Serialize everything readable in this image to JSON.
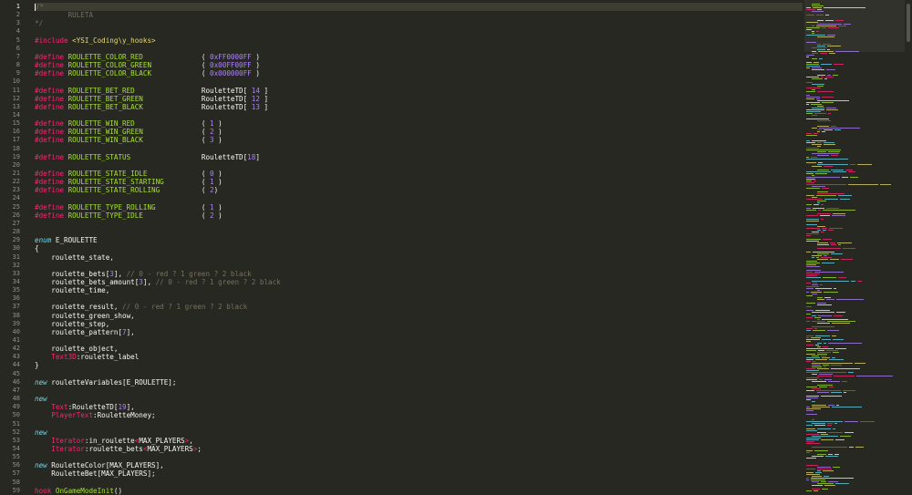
{
  "editor": {
    "theme_colors": {
      "background": "#272822",
      "comment": "#75715e",
      "preprocessor": "#f92672",
      "definition": "#a6e22e",
      "number": "#ae81ff",
      "keyword": "#66d9ef",
      "text": "#f8f8f2"
    },
    "active_line": 1,
    "lines": [
      {
        "n": "1",
        "t": [
          [
            "c-comment",
            "/*"
          ]
        ]
      },
      {
        "n": "2",
        "t": [
          [
            "c-comment",
            "        RULETA"
          ]
        ]
      },
      {
        "n": "3",
        "t": [
          [
            "c-comment",
            "*/"
          ]
        ]
      },
      {
        "n": "4",
        "t": []
      },
      {
        "n": "5",
        "t": [
          [
            "c-pre",
            "#include "
          ],
          [
            "c-str",
            "<YSI_Coding\\y_hooks>"
          ]
        ]
      },
      {
        "n": "6",
        "t": []
      },
      {
        "n": "7",
        "t": [
          [
            "c-pre",
            "#define "
          ],
          [
            "c-def",
            "ROULETTE_COLOR_RED"
          ],
          [
            "c-plain",
            "              ( "
          ],
          [
            "c-num",
            "0xFF0000FF"
          ],
          [
            "c-plain",
            " )"
          ]
        ]
      },
      {
        "n": "8",
        "t": [
          [
            "c-pre",
            "#define "
          ],
          [
            "c-def",
            "ROULETTE_COLOR_GREEN"
          ],
          [
            "c-plain",
            "            ( "
          ],
          [
            "c-num",
            "0x00FF00FF"
          ],
          [
            "c-plain",
            " )"
          ]
        ]
      },
      {
        "n": "9",
        "t": [
          [
            "c-pre",
            "#define "
          ],
          [
            "c-def",
            "ROULETTE_COLOR_BLACK"
          ],
          [
            "c-plain",
            "            ( "
          ],
          [
            "c-num",
            "0x000000FF"
          ],
          [
            "c-plain",
            " )"
          ]
        ]
      },
      {
        "n": "10",
        "t": []
      },
      {
        "n": "11",
        "t": [
          [
            "c-pre",
            "#define "
          ],
          [
            "c-def",
            "ROULETTE_BET_RED"
          ],
          [
            "c-plain",
            "                RouletteTD[ "
          ],
          [
            "c-num",
            "14"
          ],
          [
            "c-plain",
            " ]"
          ]
        ]
      },
      {
        "n": "12",
        "t": [
          [
            "c-pre",
            "#define "
          ],
          [
            "c-def",
            "ROULETTE_BET_GREEN"
          ],
          [
            "c-plain",
            "              RouletteTD[ "
          ],
          [
            "c-num",
            "12"
          ],
          [
            "c-plain",
            " ]"
          ]
        ]
      },
      {
        "n": "13",
        "t": [
          [
            "c-pre",
            "#define "
          ],
          [
            "c-def",
            "ROULETTE_BET_BLACK"
          ],
          [
            "c-plain",
            "              RouletteTD[ "
          ],
          [
            "c-num",
            "13"
          ],
          [
            "c-plain",
            " ]"
          ]
        ]
      },
      {
        "n": "14",
        "t": []
      },
      {
        "n": "15",
        "t": [
          [
            "c-pre",
            "#define "
          ],
          [
            "c-def",
            "ROULETTE_WIN_RED"
          ],
          [
            "c-plain",
            "                ( "
          ],
          [
            "c-num",
            "1"
          ],
          [
            "c-plain",
            " )"
          ]
        ]
      },
      {
        "n": "16",
        "t": [
          [
            "c-pre",
            "#define "
          ],
          [
            "c-def",
            "ROULETTE_WIN_GREEN"
          ],
          [
            "c-plain",
            "              ( "
          ],
          [
            "c-num",
            "2"
          ],
          [
            "c-plain",
            " )"
          ]
        ]
      },
      {
        "n": "17",
        "t": [
          [
            "c-pre",
            "#define "
          ],
          [
            "c-def",
            "ROULETTE_WIN_BLACK"
          ],
          [
            "c-plain",
            "              ( "
          ],
          [
            "c-num",
            "3"
          ],
          [
            "c-plain",
            " )"
          ]
        ]
      },
      {
        "n": "18",
        "t": []
      },
      {
        "n": "19",
        "t": [
          [
            "c-pre",
            "#define "
          ],
          [
            "c-def",
            "ROULETTE_STATUS"
          ],
          [
            "c-plain",
            "                 RouletteTD["
          ],
          [
            "c-num",
            "18"
          ],
          [
            "c-plain",
            "]"
          ]
        ]
      },
      {
        "n": "20",
        "t": []
      },
      {
        "n": "21",
        "t": [
          [
            "c-pre",
            "#define "
          ],
          [
            "c-def",
            "ROULETTE_STATE_IDLE"
          ],
          [
            "c-plain",
            "             ( "
          ],
          [
            "c-num",
            "0"
          ],
          [
            "c-plain",
            " )"
          ]
        ]
      },
      {
        "n": "22",
        "t": [
          [
            "c-pre",
            "#define "
          ],
          [
            "c-def",
            "ROULETTE_STATE_STARTING"
          ],
          [
            "c-plain",
            "         ( "
          ],
          [
            "c-num",
            "1"
          ],
          [
            "c-plain",
            " )"
          ]
        ]
      },
      {
        "n": "23",
        "t": [
          [
            "c-pre",
            "#define "
          ],
          [
            "c-def",
            "ROULETTE_STATE_ROLLING"
          ],
          [
            "c-plain",
            "          ( "
          ],
          [
            "c-num",
            "2"
          ],
          [
            "c-plain",
            ")"
          ]
        ]
      },
      {
        "n": "24",
        "t": []
      },
      {
        "n": "25",
        "t": [
          [
            "c-pre",
            "#define "
          ],
          [
            "c-def",
            "ROULETTE_TYPE_ROLLING"
          ],
          [
            "c-plain",
            "           ( "
          ],
          [
            "c-num",
            "1"
          ],
          [
            "c-plain",
            " )"
          ]
        ]
      },
      {
        "n": "26",
        "t": [
          [
            "c-pre",
            "#define "
          ],
          [
            "c-def",
            "ROULETTE_TYPE_IDLE"
          ],
          [
            "c-plain",
            "              ( "
          ],
          [
            "c-num",
            "2"
          ],
          [
            "c-plain",
            " )"
          ]
        ]
      },
      {
        "n": "27",
        "t": []
      },
      {
        "n": "28",
        "t": []
      },
      {
        "n": "29",
        "t": [
          [
            "c-kw",
            "enum"
          ],
          [
            "c-plain",
            " E_ROULETTE"
          ]
        ]
      },
      {
        "n": "30",
        "t": [
          [
            "c-plain",
            "{"
          ]
        ]
      },
      {
        "n": "31",
        "t": [
          [
            "c-plain",
            "    roulette_state,"
          ]
        ]
      },
      {
        "n": "32",
        "t": []
      },
      {
        "n": "33",
        "t": [
          [
            "c-plain",
            "    roulette_bets["
          ],
          [
            "c-num",
            "3"
          ],
          [
            "c-plain",
            "], "
          ],
          [
            "c-comment",
            "// 0 - red ? 1 green ? 2 black"
          ]
        ]
      },
      {
        "n": "34",
        "t": [
          [
            "c-plain",
            "    roulette_bets_amount["
          ],
          [
            "c-num",
            "3"
          ],
          [
            "c-plain",
            "], "
          ],
          [
            "c-comment",
            "// 0 - red ? 1 green ? 2 black"
          ]
        ]
      },
      {
        "n": "35",
        "t": [
          [
            "c-plain",
            "    roulette_time,"
          ]
        ]
      },
      {
        "n": "36",
        "t": []
      },
      {
        "n": "37",
        "t": [
          [
            "c-plain",
            "    roulette_result, "
          ],
          [
            "c-comment",
            "// 0 - red ? 1 green ? 2 black"
          ]
        ]
      },
      {
        "n": "38",
        "t": [
          [
            "c-plain",
            "    roulette_green_show,"
          ]
        ]
      },
      {
        "n": "39",
        "t": [
          [
            "c-plain",
            "    roulette_step,"
          ]
        ]
      },
      {
        "n": "40",
        "t": [
          [
            "c-plain",
            "    roulette_pattern["
          ],
          [
            "c-num",
            "7"
          ],
          [
            "c-plain",
            "],"
          ]
        ]
      },
      {
        "n": "41",
        "t": []
      },
      {
        "n": "42",
        "t": [
          [
            "c-plain",
            "    roulette_object,"
          ]
        ]
      },
      {
        "n": "43",
        "t": [
          [
            "c-lbl",
            "    Text3D"
          ],
          [
            "c-plain",
            ":roulette_label"
          ]
        ]
      },
      {
        "n": "44",
        "t": [
          [
            "c-plain",
            "}"
          ]
        ]
      },
      {
        "n": "45",
        "t": []
      },
      {
        "n": "46",
        "t": [
          [
            "c-kw",
            "new"
          ],
          [
            "c-plain",
            " rouletteVariables[E_ROULETTE];"
          ]
        ]
      },
      {
        "n": "47",
        "t": []
      },
      {
        "n": "48",
        "t": [
          [
            "c-kw",
            "new"
          ]
        ]
      },
      {
        "n": "49",
        "t": [
          [
            "c-lbl",
            "    Text"
          ],
          [
            "c-plain",
            ":RouletteTD["
          ],
          [
            "c-num",
            "19"
          ],
          [
            "c-plain",
            "],"
          ]
        ]
      },
      {
        "n": "50",
        "t": [
          [
            "c-lbl",
            "    PlayerText"
          ],
          [
            "c-plain",
            ":RouletteMoney;"
          ]
        ]
      },
      {
        "n": "51",
        "t": []
      },
      {
        "n": "52",
        "t": [
          [
            "c-kw",
            "new"
          ]
        ]
      },
      {
        "n": "53",
        "t": [
          [
            "c-lbl",
            "    Iterator"
          ],
          [
            "c-plain",
            ":in_roulette"
          ],
          [
            "c-tag",
            "<"
          ],
          [
            "c-plain",
            "MAX_PLAYERS"
          ],
          [
            "c-tag",
            ">"
          ],
          [
            "c-plain",
            ","
          ]
        ]
      },
      {
        "n": "54",
        "t": [
          [
            "c-lbl",
            "    Iterator"
          ],
          [
            "c-plain",
            ":roulette_bets"
          ],
          [
            "c-tag",
            "<"
          ],
          [
            "c-plain",
            "MAX_PLAYERS"
          ],
          [
            "c-tag",
            ">"
          ],
          [
            "c-plain",
            ";"
          ]
        ]
      },
      {
        "n": "55",
        "t": []
      },
      {
        "n": "56",
        "t": [
          [
            "c-kw",
            "new"
          ],
          [
            "c-plain",
            " RouletteColor[MAX_PLAYERS],"
          ]
        ]
      },
      {
        "n": "57",
        "t": [
          [
            "c-plain",
            "    RouletteBet[MAX_PLAYERS];"
          ]
        ]
      },
      {
        "n": "58",
        "t": []
      },
      {
        "n": "59",
        "t": [
          [
            "c-lbl",
            "hook"
          ],
          [
            "c-plain",
            " "
          ],
          [
            "c-ent",
            "OnGameModeInit"
          ],
          [
            "c-plain",
            "()"
          ]
        ]
      }
    ]
  },
  "minimap": {
    "label": "minimap",
    "line_colors": [
      "#a6e22e",
      "#f92672",
      "#ae81ff",
      "#f8f8f2",
      "#75715e",
      "#66d9ef",
      "#e6db74"
    ]
  }
}
